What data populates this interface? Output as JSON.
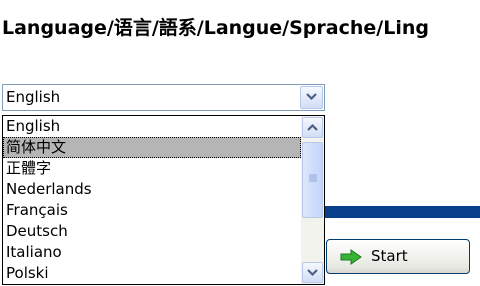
{
  "header": {
    "title": "Language/语言/語系/Langue/Sprache/Ling"
  },
  "language_select": {
    "selected_value": "English",
    "options": [
      "English",
      "简体中文",
      "正體字",
      "Nederlands",
      "Français",
      "Deutsch",
      "Italiano",
      "Polski"
    ],
    "highlighted_option": "简体中文"
  },
  "buttons": {
    "start_label": "Start"
  },
  "icons": {
    "combo_dropdown": "chevron-down-icon",
    "scroll_up": "chevron-up-icon",
    "scroll_down": "chevron-down-icon",
    "scroll_grip": "grip-icon",
    "start": "green-arrow-right-icon"
  },
  "colors": {
    "accent_bar": "#0a3f8c",
    "selection": "#b5b5b5",
    "arrow_green": "#2fa82f"
  }
}
